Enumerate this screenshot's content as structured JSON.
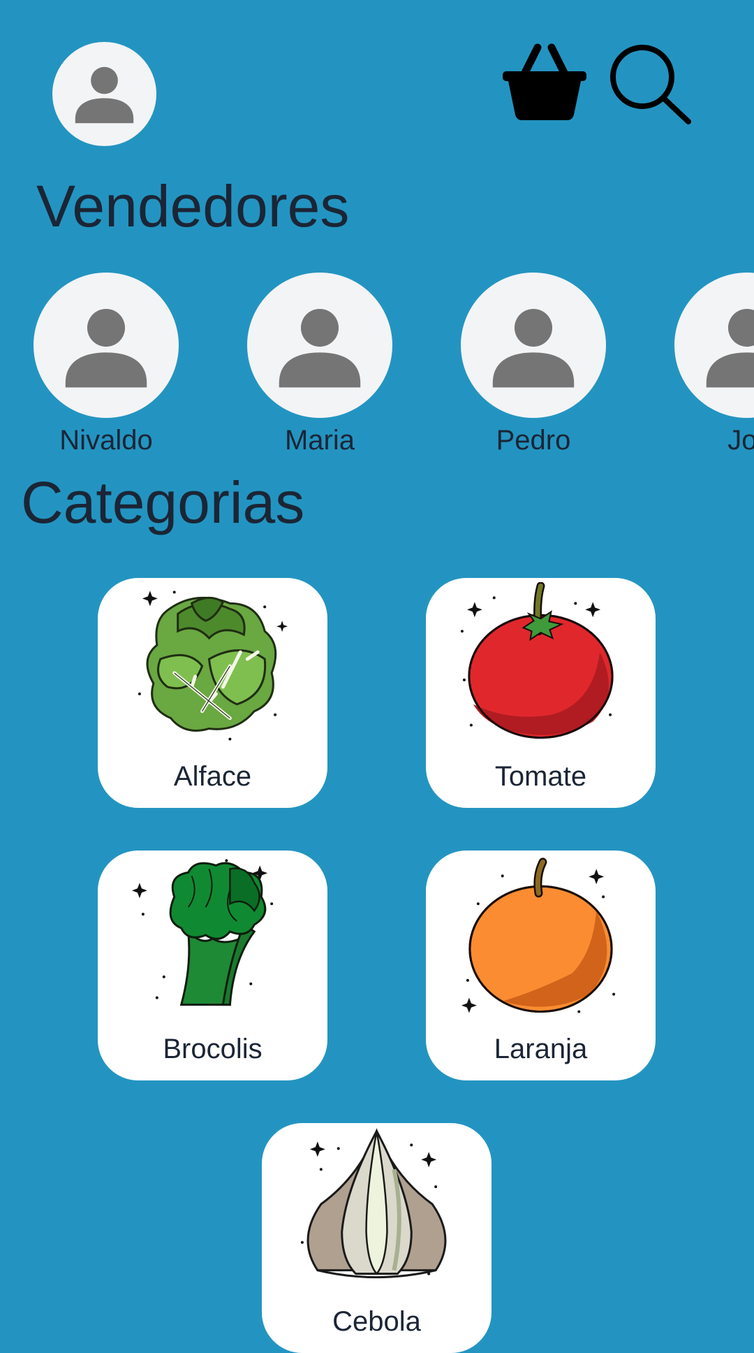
{
  "header": {
    "profile_icon": "person-icon",
    "cart_icon": "basket-icon",
    "search_icon": "search-icon"
  },
  "vendors": {
    "title": "Vendedores",
    "items": [
      {
        "name": "Nivaldo",
        "icon": "person-icon"
      },
      {
        "name": "Maria",
        "icon": "person-icon"
      },
      {
        "name": "Pedro",
        "icon": "person-icon"
      },
      {
        "name": "Jor",
        "icon": "person-icon"
      }
    ]
  },
  "categories": {
    "title": "Categorias",
    "items": [
      {
        "label": "Alface",
        "icon": "lettuce-icon"
      },
      {
        "label": "Tomate",
        "icon": "tomato-icon"
      },
      {
        "label": "Brocolis",
        "icon": "broccoli-icon"
      },
      {
        "label": "Laranja",
        "icon": "orange-icon"
      },
      {
        "label": "Cebola",
        "icon": "garlic-icon"
      }
    ]
  },
  "colors": {
    "background": "#2394c1",
    "card": "#ffffff",
    "avatar_bg": "#f3f4f6",
    "avatar_icon": "#757575",
    "text": "#1b2535"
  }
}
